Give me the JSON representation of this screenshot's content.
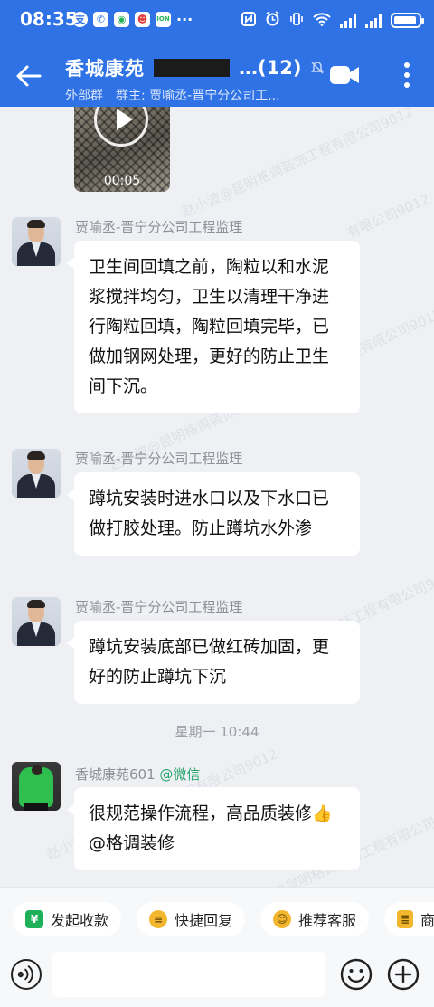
{
  "status_bar": {
    "time": "08:35",
    "notif_icons": [
      "支",
      "✆",
      "◉",
      "☻",
      "ION",
      "···"
    ]
  },
  "header": {
    "title": "香城康苑",
    "count": "…(12)",
    "group_type": "外部群",
    "group_owner": "群主: 贾喻丞-晋宁分公司工..."
  },
  "video": {
    "duration": "00:05"
  },
  "messages": [
    {
      "sender": "贾喻丞-晋宁分公司工程监理",
      "text": "卫生间回填之前，陶粒以和水泥浆搅拌均匀，卫生以清理干净进行陶粒回填，陶粒回填完毕，已做加钢网处理，更好的防止卫生间下沉。"
    },
    {
      "sender": "贾喻丞-晋宁分公司工程监理",
      "text": "蹲坑安装时进水口以及下水口已做打胶处理。防止蹲坑水外渗"
    },
    {
      "sender": "贾喻丞-晋宁分公司工程监理",
      "text": "蹲坑安装底部已做红砖加固，更好的防止蹲坑下沉"
    },
    {
      "sender": "香城康苑601",
      "sender_tag": "@微信",
      "text_a": "很规范操作流程，高品质装修",
      "emoji": "👍",
      "text_b": "@格调装修"
    }
  ],
  "timestamp": "星期一  10:44",
  "watermarks": [
    "赵小波@昆明格调装饰工程有限公司9012",
    "有限公司9012",
    "赵小波@昆明格调装饰工程有限公司9012",
    "赵小波@昆明格调装饰工程有限公司9012",
    "赵小波@昆明格调装饰工程有限公司9012",
    "程有限公司9012",
    "赵小波@昆明格调装饰工程有限公司9012"
  ],
  "quick_actions": [
    {
      "label": "发起收款",
      "icon": "¥"
    },
    {
      "label": "快捷回复",
      "icon": "≡"
    },
    {
      "label": "推荐客服",
      "icon": "☺"
    },
    {
      "label": "商",
      "icon": "≣"
    }
  ],
  "input": {
    "placeholder": ""
  },
  "colors": {
    "header_blue": "#2e72e6",
    "chat_bg": "#eef0f3",
    "mention_green": "#24a36b"
  }
}
